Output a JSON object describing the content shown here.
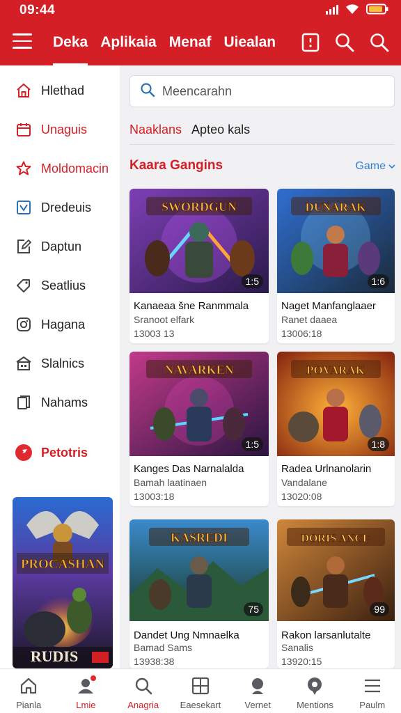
{
  "status": {
    "time": "09:44"
  },
  "header": {
    "tabs": [
      {
        "label": "Deka",
        "active": true
      },
      {
        "label": "Aplikaia",
        "active": false
      },
      {
        "label": "Menaf",
        "active": false
      },
      {
        "label": "Uiealan",
        "active": false
      }
    ],
    "icons": [
      "hamburger-icon",
      "bookmark-icon",
      "search-icon",
      "search-icon"
    ],
    "accent": "#d51f26"
  },
  "sidebar": {
    "items": [
      {
        "label": "Hlethad",
        "icon": "home-icon",
        "highlight": false
      },
      {
        "label": "Unaguis",
        "icon": "calendar-icon",
        "highlight": true
      },
      {
        "label": "Moldomacin",
        "icon": "star-icon",
        "highlight": true
      },
      {
        "label": "Dredeuis",
        "icon": "photo-icon",
        "highlight": false
      },
      {
        "label": "Daptun",
        "icon": "edit-icon",
        "highlight": false
      },
      {
        "label": "Seatlius",
        "icon": "tag-icon",
        "highlight": false
      },
      {
        "label": "Hagana",
        "icon": "camera-icon",
        "highlight": false
      },
      {
        "label": "Slalnics",
        "icon": "store-icon",
        "highlight": false
      },
      {
        "label": "Nahams",
        "icon": "book-icon",
        "highlight": false
      },
      {
        "label": "Petotris",
        "icon": "red-circle-icon",
        "highlight": true
      }
    ],
    "promo": {
      "title": "PROCASHAN",
      "footer": "RUDIS"
    }
  },
  "main": {
    "search_placeholder": "Meencarahn",
    "subtabs": [
      {
        "label": "Naaklans",
        "active": true
      },
      {
        "label": "Apteo kals",
        "active": false
      }
    ],
    "section_title": "Kaara Gangins",
    "section_more": "Game",
    "cards": [
      {
        "title": "Kanaeaa šne Ranmmala",
        "subtitle": "Sranoot elfark",
        "date": "13003 13",
        "badge": "1:5",
        "art": "SWORDGUN"
      },
      {
        "title": "Naget Manfanglaaer",
        "subtitle": "Ranet daaea",
        "date": "13006:18",
        "badge": "1:6",
        "art": "DUNARAK"
      },
      {
        "title": "Kanges Das Narnalalda",
        "subtitle": "Bamah laatinaen",
        "date": "13003:18",
        "badge": "1:5",
        "art": "NAVARKEN"
      },
      {
        "title": "Radea Urlnanolarin",
        "subtitle": "Vandalane",
        "date": "13020:08",
        "badge": "1:8",
        "art": "POVARAK"
      },
      {
        "title": "Dandet Ung Nmnaelka",
        "subtitle": "Bamad Sams",
        "date": "13938:38",
        "badge": "75",
        "art": "KASREDI"
      },
      {
        "title": "Rakon larsanlutalte",
        "subtitle": "Sanalis",
        "date": "13920:15",
        "badge": "99",
        "art": "DORIS ANCE"
      }
    ]
  },
  "bottom_nav": [
    {
      "label": "Pianla",
      "icon": "home-icon",
      "active": false
    },
    {
      "label": "Lmie",
      "icon": "person-icon",
      "active": true,
      "dot": true
    },
    {
      "label": "Anagria",
      "icon": "search-icon",
      "active": true
    },
    {
      "label": "Eaesekart",
      "icon": "grid-icon",
      "active": false
    },
    {
      "label": "Vernet",
      "icon": "chat-icon",
      "active": false
    },
    {
      "label": "Mentions",
      "icon": "location-icon",
      "active": false
    },
    {
      "label": "Paulm",
      "icon": "menu-icon",
      "active": false
    }
  ]
}
